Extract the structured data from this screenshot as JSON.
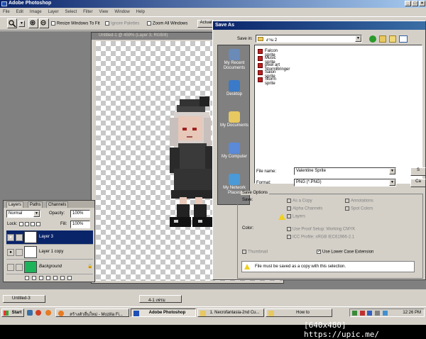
{
  "app": {
    "title": "Adobe Photoshop",
    "menu": [
      "File",
      "Edit",
      "Image",
      "Layer",
      "Select",
      "Filter",
      "View",
      "Window",
      "Help"
    ]
  },
  "options_bar": {
    "resize_windows": "Resize Windows To Fit",
    "ignore_palettes": "Ignore Palettes",
    "zoom_all_windows": "Zoom All Windows",
    "actual_pixels": "Actual"
  },
  "document": {
    "title": "Untitled-1 @ 459% (Layer 3, RGB/8)"
  },
  "layers_panel": {
    "tabs": [
      "Layers",
      "Paths",
      "Channels"
    ],
    "blend_mode": "Normal",
    "opacity_label": "Opacity:",
    "opacity_value": "100%",
    "lock_label": "Lock:",
    "fill_label": "Fill:",
    "fill_value": "100%",
    "layers": [
      {
        "name": "Layer 3",
        "selected": true
      },
      {
        "name": "Layer 1 copy",
        "selected": false
      },
      {
        "name": "Background",
        "selected": false
      }
    ]
  },
  "save_dialog": {
    "title": "Save As",
    "save_in_label": "Save in:",
    "save_in_value": "งาน 2",
    "places": [
      "My Recent Documents",
      "Desktop",
      "My Documents",
      "My Computer",
      "My Network Places"
    ],
    "files": [
      "Falcon sprite",
      "Music sprite",
      "pixel art StormBringer",
      "Saion sprite",
      "Storm sprite"
    ],
    "file_name_label": "File name:",
    "file_name_value": "Valentine Sprite",
    "format_label": "Format:",
    "format_value": "PNG (*.PNG)",
    "save_button": "S",
    "cancel_button": "Ca",
    "options_title": "Save Options",
    "save_label": "Save:",
    "as_a_copy": "As a Copy",
    "annotations": "Annotations",
    "alpha_channels": "Alpha Channels",
    "spot_colors": "Spot Colors",
    "layers": "Layers",
    "color_label": "Color:",
    "use_proof_setup": "Use Proof Setup: Working CMYK",
    "icc_profile": "ICC Profile: sRGB IEC61966-2.1",
    "thumbnail": "Thumbnail",
    "lower_case": "Use Lower Case Extension",
    "warning": "File must be saved as a copy with this selection."
  },
  "minimized": [
    "Untitled-3",
    "4-1 เฟรม"
  ],
  "taskbar": {
    "start": "Start",
    "tasks": [
      "สร้างตัวอื่นใหม่ - Mozilla Fi...",
      "Adobe Photoshop",
      "1. Necrofantasia-2nd Cu...",
      "How to"
    ],
    "clock": "12:26 PM"
  },
  "watermark": "[640x480] https://upic.me/"
}
